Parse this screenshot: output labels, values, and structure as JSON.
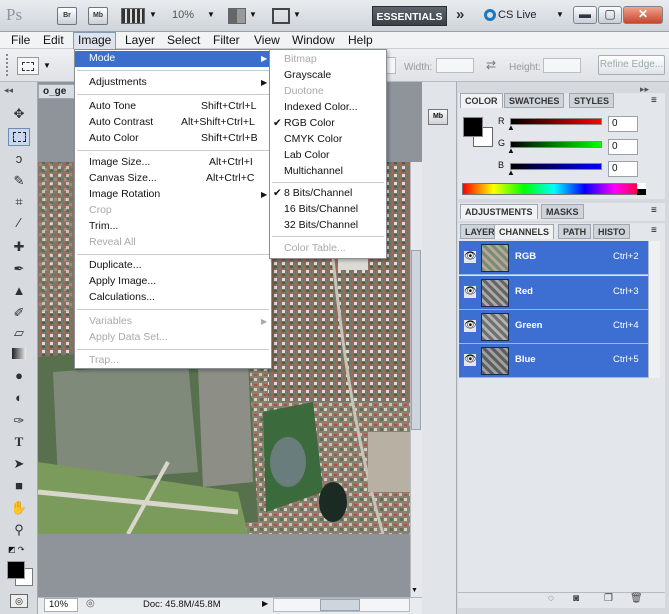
{
  "app": {
    "logo": "Ps",
    "icons": [
      "Br",
      "Mb"
    ],
    "zoom": "10%",
    "workspace": "ESSENTIALS",
    "cslive": "CS Live"
  },
  "menubar": [
    "File",
    "Edit",
    "Image",
    "Layer",
    "Select",
    "Filter",
    "View",
    "Window",
    "Help"
  ],
  "options": {
    "width_label": "Width:",
    "height_label": "Height:",
    "refine": "Refine Edge..."
  },
  "document": {
    "tab": "o_ge",
    "status_zoom": "10%",
    "status_doc": "Doc: 45.8M/45.8M"
  },
  "image_menu": {
    "mode": "Mode",
    "adjustments": "Adjustments",
    "auto_tone": "Auto Tone",
    "auto_tone_sc": "Shift+Ctrl+L",
    "auto_contrast": "Auto Contrast",
    "auto_contrast_sc": "Alt+Shift+Ctrl+L",
    "auto_color": "Auto Color",
    "auto_color_sc": "Shift+Ctrl+B",
    "image_size": "Image Size...",
    "image_size_sc": "Alt+Ctrl+I",
    "canvas_size": "Canvas Size...",
    "canvas_size_sc": "Alt+Ctrl+C",
    "image_rotation": "Image Rotation",
    "crop": "Crop",
    "trim": "Trim...",
    "reveal_all": "Reveal All",
    "duplicate": "Duplicate...",
    "apply_image": "Apply Image...",
    "calculations": "Calculations...",
    "variables": "Variables",
    "apply_data_set": "Apply Data Set...",
    "trap": "Trap..."
  },
  "mode_menu": {
    "bitmap": "Bitmap",
    "grayscale": "Grayscale",
    "duotone": "Duotone",
    "indexed": "Indexed Color...",
    "rgb": "RGB Color",
    "cmyk": "CMYK Color",
    "lab": "Lab Color",
    "multichannel": "Multichannel",
    "bits8": "8 Bits/Channel",
    "bits16": "16 Bits/Channel",
    "bits32": "32 Bits/Channel",
    "color_table": "Color Table..."
  },
  "color_panel": {
    "tabs": [
      "COLOR",
      "SWATCHES",
      "STYLES"
    ],
    "r_label": "R",
    "g_label": "G",
    "b_label": "B",
    "r": "0",
    "g": "0",
    "b": "0"
  },
  "adj_panel": {
    "tabs": [
      "ADJUSTMENTS",
      "MASKS"
    ]
  },
  "channels_panel": {
    "tabs": [
      "LAYER",
      "CHANNELS",
      "PATH",
      "HISTO"
    ],
    "rows": [
      {
        "name": "RGB",
        "shortcut": "Ctrl+2"
      },
      {
        "name": "Red",
        "shortcut": "Ctrl+3"
      },
      {
        "name": "Green",
        "shortcut": "Ctrl+4"
      },
      {
        "name": "Blue",
        "shortcut": "Ctrl+5"
      }
    ]
  }
}
